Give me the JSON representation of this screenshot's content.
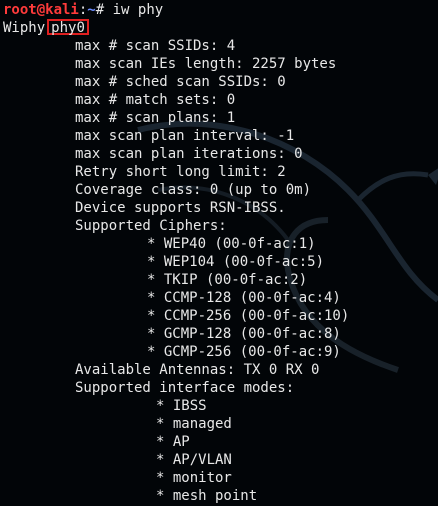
{
  "prompt": {
    "user_host": "root@kali",
    "separator": ":",
    "path": "~",
    "symbol": "#",
    "command": "iw phy"
  },
  "wiphy": {
    "label": "Wiphy",
    "name": "phy0"
  },
  "properties": [
    "max # scan SSIDs: 4",
    "max scan IEs length: 2257 bytes",
    "max # sched scan SSIDs: 0",
    "max # match sets: 0",
    "max # scan plans: 1",
    "max scan plan interval: -1",
    "max scan plan iterations: 0",
    "Retry short long limit: 2",
    "Coverage class: 0 (up to 0m)",
    "Device supports RSN-IBSS.",
    "Supported Ciphers:"
  ],
  "ciphers": [
    "* WEP40 (00-0f-ac:1)",
    "* WEP104 (00-0f-ac:5)",
    "* TKIP (00-0f-ac:2)",
    "* CCMP-128 (00-0f-ac:4)",
    "* CCMP-256 (00-0f-ac:10)",
    "* GCMP-128 (00-0f-ac:8)",
    "* GCMP-256 (00-0f-ac:9)"
  ],
  "antennas": "Available Antennas: TX 0 RX 0",
  "modes_header": "Supported interface modes:",
  "modes": [
    "* IBSS",
    "* managed",
    "* AP",
    "* AP/VLAN",
    "* monitor",
    "* mesh point"
  ],
  "colors": {
    "background": "#020508",
    "text": "#e8e8e8",
    "prompt_user": "#ff3b3b",
    "prompt_path": "#6c8cff",
    "highlight_border": "#e02020"
  }
}
